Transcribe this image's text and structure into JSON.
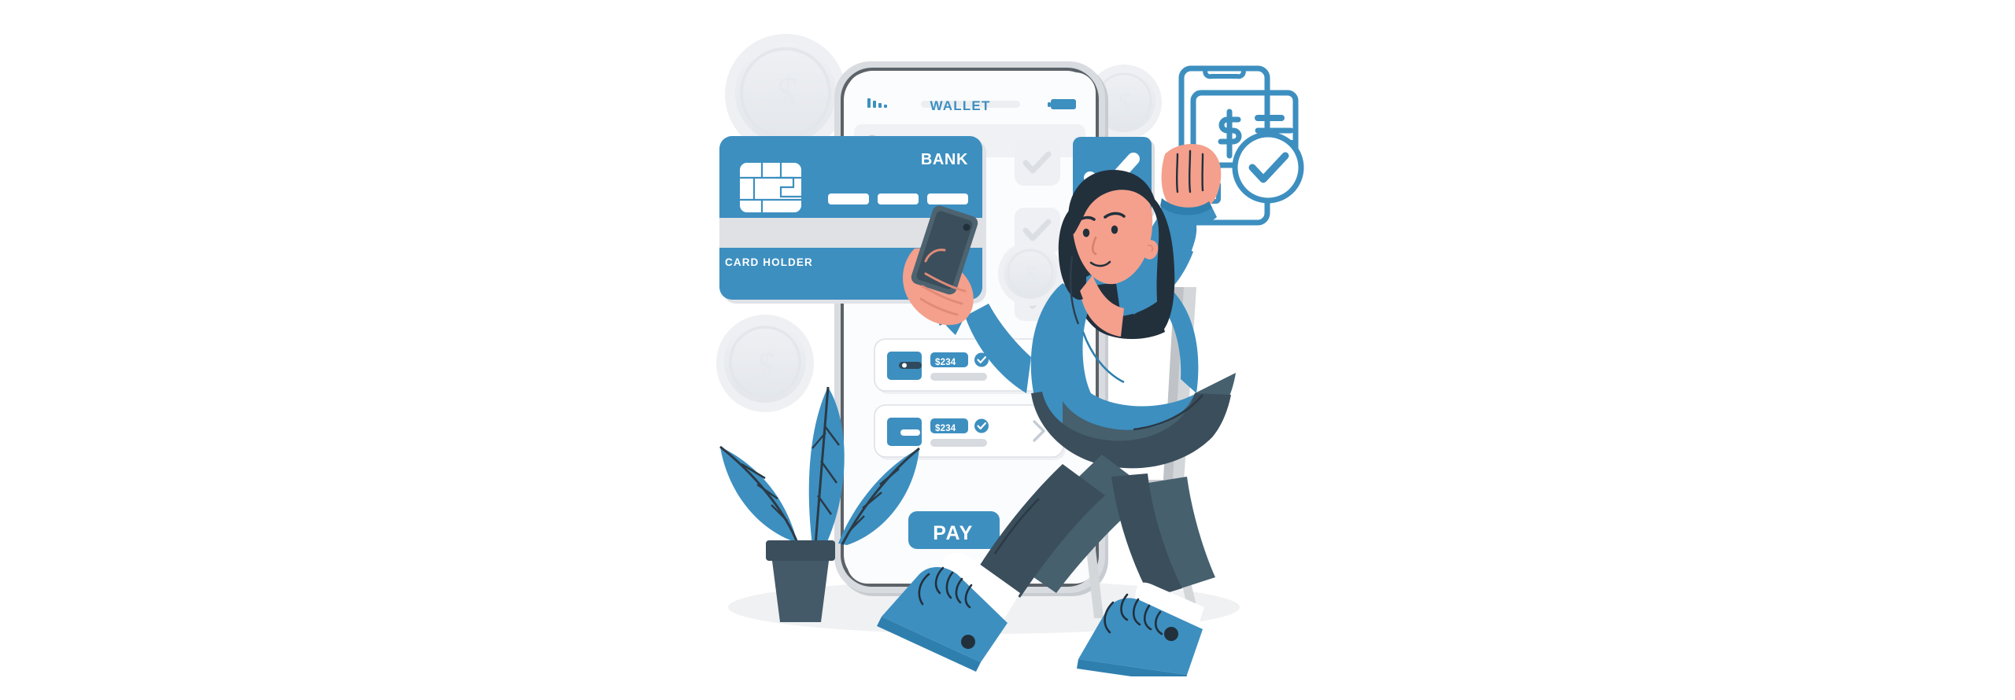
{
  "scene": {
    "title": "Online payment / wallet flat illustration",
    "background_color": "#ffffff",
    "palette": {
      "brand_blue": "#3d8fc0",
      "deep_navy": "#3b4e5c",
      "light_gray": "#e8eaee",
      "mid_gray": "#c9cdd3",
      "skin": "#f4a08c",
      "hair_dark": "#22303c",
      "denim": "#46606e",
      "white": "#ffffff"
    }
  },
  "phone": {
    "status_bar": {
      "signal_icon": "signal-bars-icon",
      "battery_icon": "battery-icon",
      "carrier_placeholder": ""
    },
    "header": {
      "back_dot_icon": "back-dot-icon",
      "title": "WALLET"
    },
    "home_indicator": "home-indicator"
  },
  "bank_card": {
    "chip_icon": "chip-icon",
    "brand": "BANK",
    "number_groups": [
      "",
      "",
      ""
    ],
    "magnetic_stripe": "magnetic-stripe",
    "holder_label": "CARD HOLDER"
  },
  "checklist": {
    "items": [
      {
        "state": "unchecked",
        "icon": "check-icon"
      },
      {
        "state": "unchecked",
        "icon": "check-icon"
      },
      {
        "state": "unchecked",
        "icon": "check-icon"
      }
    ],
    "featured": {
      "state": "checked",
      "icon": "check-icon",
      "color": "#3d8fc0"
    }
  },
  "transactions": [
    {
      "icon": "wallet-icon",
      "amount": "$234",
      "verified_icon": "verified-check-icon",
      "detail_placeholder": "",
      "chevron_icon": "chevron-right-icon"
    },
    {
      "icon": "card-icon",
      "amount": "$234",
      "verified_icon": "verified-check-icon",
      "detail_placeholder": "",
      "chevron_icon": "chevron-right-icon"
    }
  ],
  "pay_button": {
    "label": "PAY",
    "color": "#3d8fc0"
  },
  "decor": {
    "coins": [
      {
        "name": "coin-top-left",
        "symbol": "$"
      },
      {
        "name": "coin-top-right",
        "symbol": "$"
      },
      {
        "name": "coin-mid-left",
        "symbol": "$"
      },
      {
        "name": "coin-behind-person",
        "symbol": "$"
      }
    ],
    "invoice_icon": "mobile-invoice-check-icon",
    "plant_icon": "potted-plant-icon",
    "chair_icon": "chair-icon",
    "person_icon": "person-with-phone-icon",
    "ground_shadow": "ground-shadow"
  }
}
